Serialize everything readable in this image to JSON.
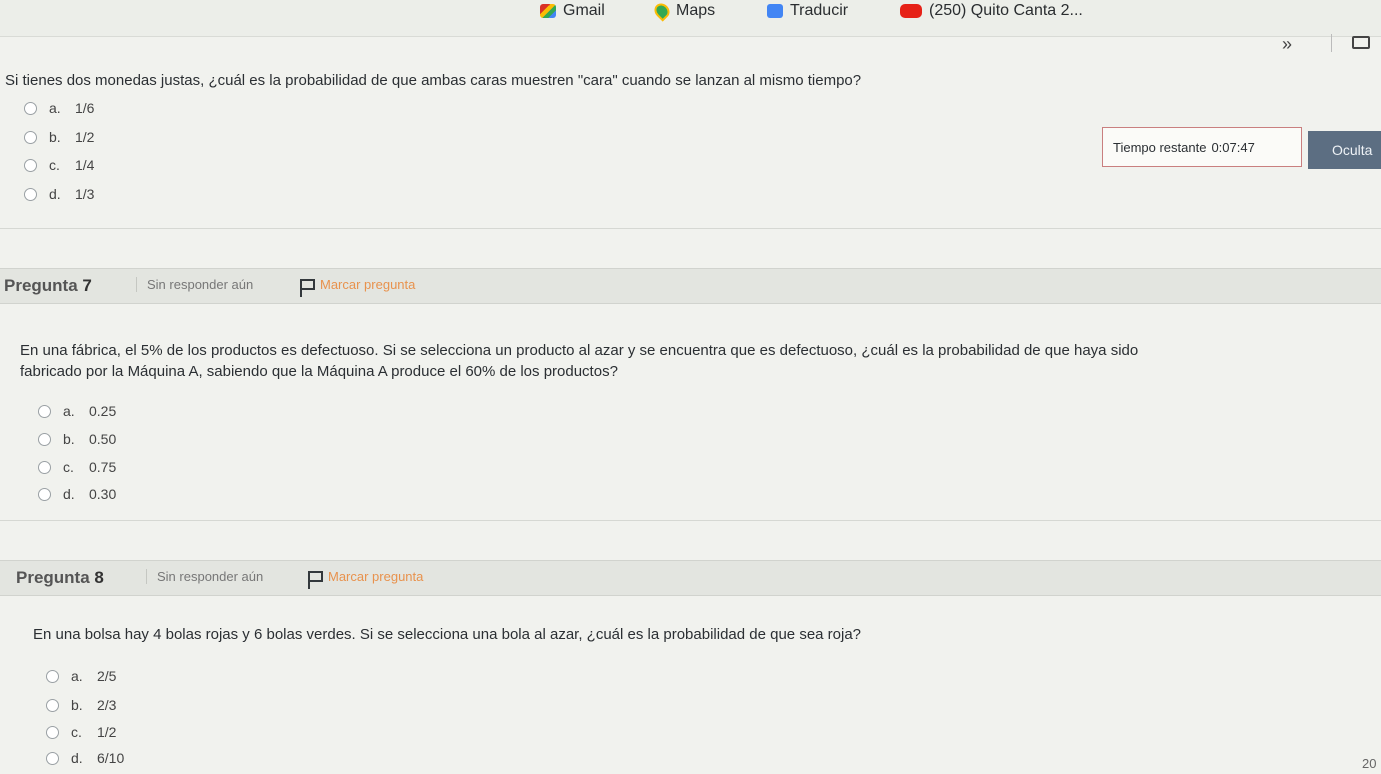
{
  "bookmarks": [
    {
      "label": "Gmail",
      "icon": "gmail-icon"
    },
    {
      "label": "Maps",
      "icon": "maps-icon"
    },
    {
      "label": "Traducir",
      "icon": "translate-icon"
    },
    {
      "label": "(250) Quito Canta 2...",
      "icon": "youtube-icon"
    }
  ],
  "toolbar": {
    "overflow": "»"
  },
  "q6": {
    "text": "Si tienes dos monedas justas, ¿cuál es la probabilidad de que ambas caras muestren \"cara\" cuando se lanzan al mismo tiempo?",
    "options": [
      {
        "letter": "a.",
        "value": "1/6"
      },
      {
        "letter": "b.",
        "value": "1/2"
      },
      {
        "letter": "c.",
        "value": "1/4"
      },
      {
        "letter": "d.",
        "value": "1/3"
      }
    ]
  },
  "timer": {
    "label": "Tiempo restante",
    "value": "0:07:47",
    "hide_label": "Oculta"
  },
  "q7": {
    "title": "Pregunta",
    "number": "7",
    "status": "Sin responder aún",
    "flag_label": "Marcar pregunta",
    "text_line1": "En una fábrica, el 5% de los productos es defectuoso. Si se selecciona un producto al azar y se encuentra que es defectuoso, ¿cuál es la probabilidad de que haya sido",
    "text_line2": "fabricado por la Máquina A, sabiendo que la Máquina A produce el 60% de los productos?",
    "options": [
      {
        "letter": "a.",
        "value": "0.25"
      },
      {
        "letter": "b.",
        "value": "0.50"
      },
      {
        "letter": "c.",
        "value": "0.75"
      },
      {
        "letter": "d.",
        "value": "0.30"
      }
    ]
  },
  "q8": {
    "title": "Pregunta",
    "number": "8",
    "status": "Sin responder aún",
    "flag_label": "Marcar pregunta",
    "text": "En una bolsa hay 4 bolas rojas y 6 bolas verdes. Si se selecciona una bola al azar, ¿cuál es la probabilidad de que sea roja?",
    "options": [
      {
        "letter": "a.",
        "value": "2/5"
      },
      {
        "letter": "b.",
        "value": "2/3"
      },
      {
        "letter": "c.",
        "value": "1/2"
      },
      {
        "letter": "d.",
        "value": "6/10"
      }
    ]
  },
  "footer": {
    "corner_number": "20"
  }
}
